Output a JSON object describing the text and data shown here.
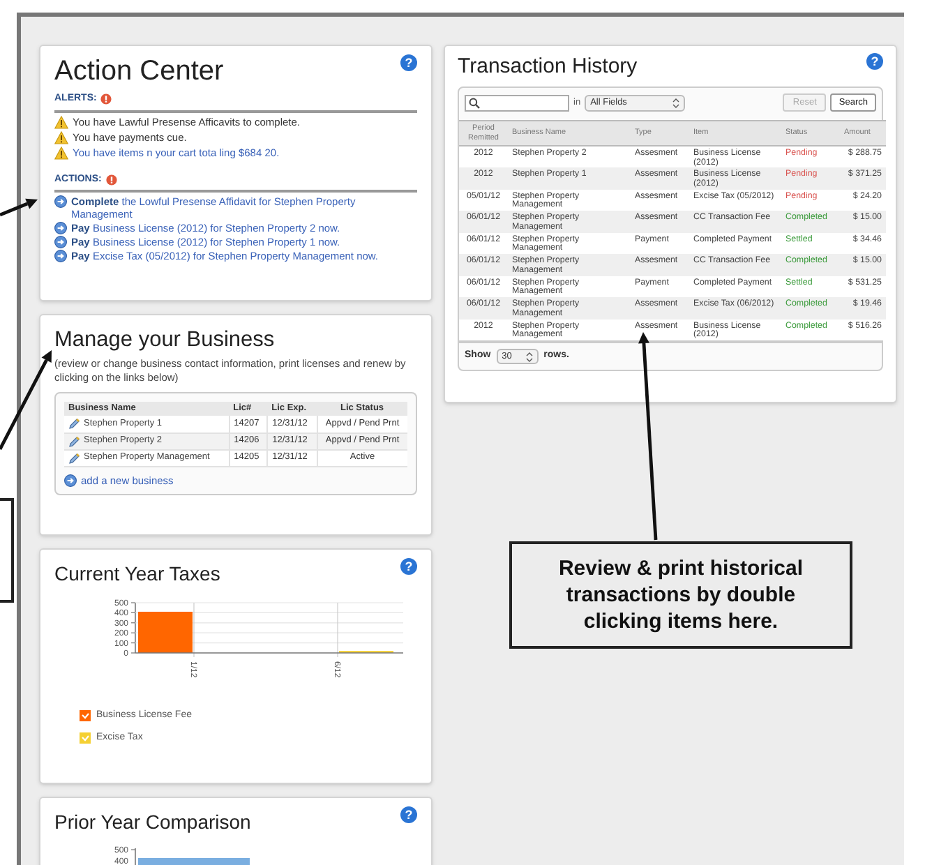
{
  "action_center": {
    "title": "Action Center",
    "help": "?",
    "alerts_label": "ALERTS:",
    "alerts": [
      {
        "text": "You have Lawful Presense Afficavits to complete.",
        "link": false
      },
      {
        "text": "You have payments cue.",
        "link": false
      },
      {
        "text": "You have items n your cart tota ling $684 20.",
        "link": true
      }
    ],
    "actions_label": "ACTIONS:",
    "actions": [
      "**Complete** the Lowful Presense Affidavit for Stephen Property Management",
      "**Pay** Business License (2012) for Stephen Property 2 now.",
      "**Pay** Business License (2012) for Stephen Property 1 now.",
      "**Pay** Excise Tax (05/2012) for Stephen Property Management now."
    ]
  },
  "manage_business": {
    "title": "Manage your Business",
    "description": "(review or change business contact information, print licenses and renew by clicking on the links below)",
    "columns": [
      "Business Name",
      "Lic#",
      "Lic Exp.",
      "Lic Status"
    ],
    "rows": [
      [
        "Stephen Property 1",
        "14207",
        "12/31/12",
        "Appvd / Pend Prnt"
      ],
      [
        "Stephen Property 2",
        "14206",
        "12/31/12",
        "Appvd / Pend Prnt"
      ],
      [
        "Stephen Property Management",
        "14205",
        "12/31/12",
        "Active"
      ]
    ],
    "add_link": "add a new business"
  },
  "current_year_taxes": {
    "title": "Current Year Taxes",
    "help": "?",
    "chart_data": {
      "type": "bar",
      "grid": true,
      "categories": [
        "1/12",
        "6/12"
      ],
      "yticks": [
        0,
        100,
        200,
        300,
        400,
        500
      ],
      "ylim": [
        0,
        500
      ],
      "series": [
        {
          "name": "Business License Fee",
          "color": "#ff6600",
          "values": [
            410,
            0
          ]
        },
        {
          "name": "Excise Tax",
          "color": "#f5d033",
          "values": [
            0,
            20
          ]
        }
      ]
    }
  },
  "prior_year_comparison": {
    "title": "Prior Year Comparison",
    "help": "?",
    "y_tick_labels": [
      "500",
      "400"
    ]
  },
  "transaction_history": {
    "title": "Transaction History",
    "help": "?",
    "in_label": "in",
    "field_select": "All Fields",
    "reset": {
      "label": "Reset",
      "disabled": true
    },
    "search_button": "Search",
    "columns": [
      "Period Remitted",
      "Business Name",
      "Type",
      "Item",
      "Status",
      "Amount"
    ],
    "rows": [
      {
        "period": "2012",
        "business": "Stephen Property 2",
        "type": "Assesment",
        "item": "Business License (2012)",
        "status": "Pending",
        "color": "#d9534f",
        "amount": "$ 288.75"
      },
      {
        "period": "2012",
        "business": "Stephen Property 1",
        "type": "Assesment",
        "item": "Business License (2012)",
        "status": "Pending",
        "color": "#d9534f",
        "amount": "$ 371.25"
      },
      {
        "period": "05/01/12",
        "business": "Stephen Property Management",
        "type": "Assesment",
        "item": "Excise Tax (05/2012)",
        "status": "Pending",
        "color": "#d9534f",
        "amount": "$ 24.20"
      },
      {
        "period": "06/01/12",
        "business": "Stephen Property Management",
        "type": "Assesment",
        "item": "CC Transaction Fee",
        "status": "Completed",
        "color": "#3a9a3a",
        "amount": "$ 15.00"
      },
      {
        "period": "06/01/12",
        "business": "Stephen Property Management",
        "type": "Payment",
        "item": "Completed Payment",
        "status": "Settled",
        "color": "#3a9a3a",
        "amount": "$ 34.46"
      },
      {
        "period": "06/01/12",
        "business": "Stephen Property Management",
        "type": "Assesment",
        "item": "CC Transaction Fee",
        "status": "Completed",
        "color": "#3a9a3a",
        "amount": "$ 15.00"
      },
      {
        "period": "06/01/12",
        "business": "Stephen Property Management",
        "type": "Payment",
        "item": "Completed Payment",
        "status": "Settled",
        "color": "#3a9a3a",
        "amount": "$ 531.25"
      },
      {
        "period": "06/01/12",
        "business": "Stephen Property Management",
        "type": "Assesment",
        "item": "Excise Tax (06/2012)",
        "status": "Completed",
        "color": "#3a9a3a",
        "amount": "$ 19.46"
      },
      {
        "period": "2012",
        "business": "Stephen Property Management",
        "type": "Assesment",
        "item": "Business License (2012)",
        "status": "Completed",
        "color": "#3a9a3a",
        "amount": "$ 516.26"
      }
    ],
    "show_label": "Show",
    "rows_select": "30",
    "rows_label": "rows."
  },
  "annotation": {
    "text": "Review & print historical transactions by double clicking items here."
  }
}
